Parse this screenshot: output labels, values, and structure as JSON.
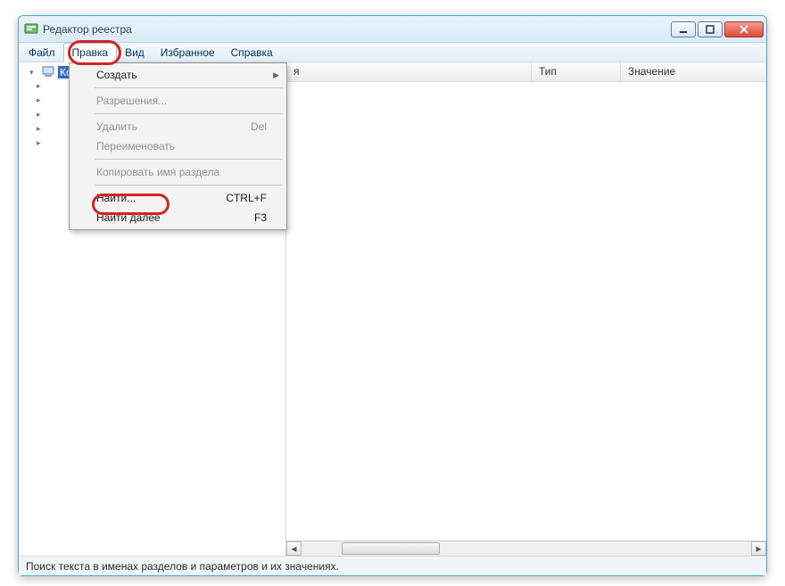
{
  "window": {
    "title": "Редактор реестра"
  },
  "menubar": {
    "file": "Файл",
    "edit": "Правка",
    "view": "Вид",
    "favorites": "Избранное",
    "help": "Справка"
  },
  "edit_menu": {
    "create": "Создать",
    "permissions": "Разрешения...",
    "delete": "Удалить",
    "delete_sc": "Del",
    "rename": "Переименовать",
    "copy_key": "Копировать имя раздела",
    "find": "Найти...",
    "find_sc": "CTRL+F",
    "find_next": "Найти далее",
    "find_next_sc": "F3"
  },
  "tree": {
    "root": "Компьютер"
  },
  "columns": {
    "name": "Имя",
    "type": "Тип",
    "value": "Значение",
    "name_remainder": "я"
  },
  "status": "Поиск текста в именах разделов и параметров и их значениях."
}
